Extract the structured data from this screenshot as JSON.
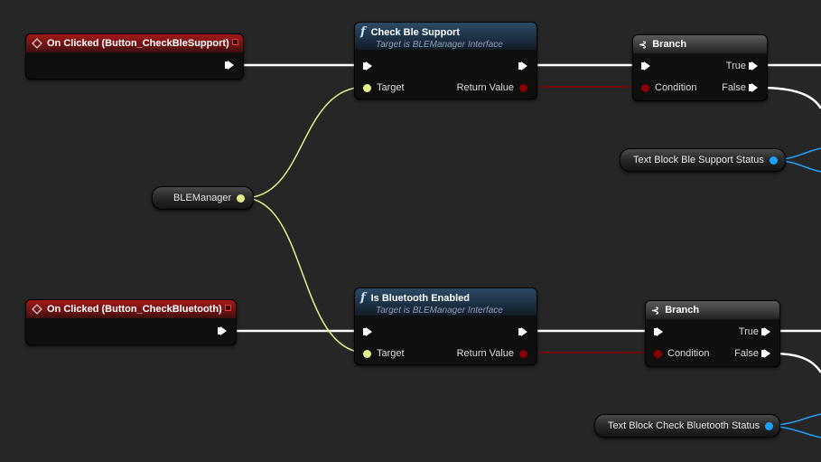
{
  "graph": {
    "event_check_ble": {
      "title": "On Clicked (Button_CheckBleSupport)"
    },
    "event_check_bluetooth": {
      "title": "On Clicked (Button_CheckBluetooth)"
    },
    "func_check_ble": {
      "title": "Check Ble Support",
      "subtitle": "Target is BLEManager Interface",
      "target_label": "Target",
      "return_label": "Return Value"
    },
    "func_bt_enabled": {
      "title": "Is Bluetooth Enabled",
      "subtitle": "Target is BLEManager Interface",
      "target_label": "Target",
      "return_label": "Return Value"
    },
    "branch_1": {
      "title": "Branch",
      "condition_label": "Condition",
      "true_label": "True",
      "false_label": "False"
    },
    "branch_2": {
      "title": "Branch",
      "condition_label": "Condition",
      "true_label": "True",
      "false_label": "False"
    },
    "var_ble_manager": {
      "label": "BLEManager"
    },
    "var_text_ble_status": {
      "label": "Text Block Ble Support Status"
    },
    "var_text_bt_status": {
      "label": "Text Block Check Bluetooth Status"
    }
  },
  "colors": {
    "background": "#262626",
    "exec_wire": "#ffffff",
    "object_wire": "#e6f08a",
    "bool_wire": "#8a0000",
    "text_wire": "#1ea0ff",
    "event_header": "#a01818",
    "function_header": "#2c4a66"
  },
  "icons": {
    "event": "event-diamond-icon",
    "function": "function-f-icon",
    "branch": "branch-icon"
  }
}
